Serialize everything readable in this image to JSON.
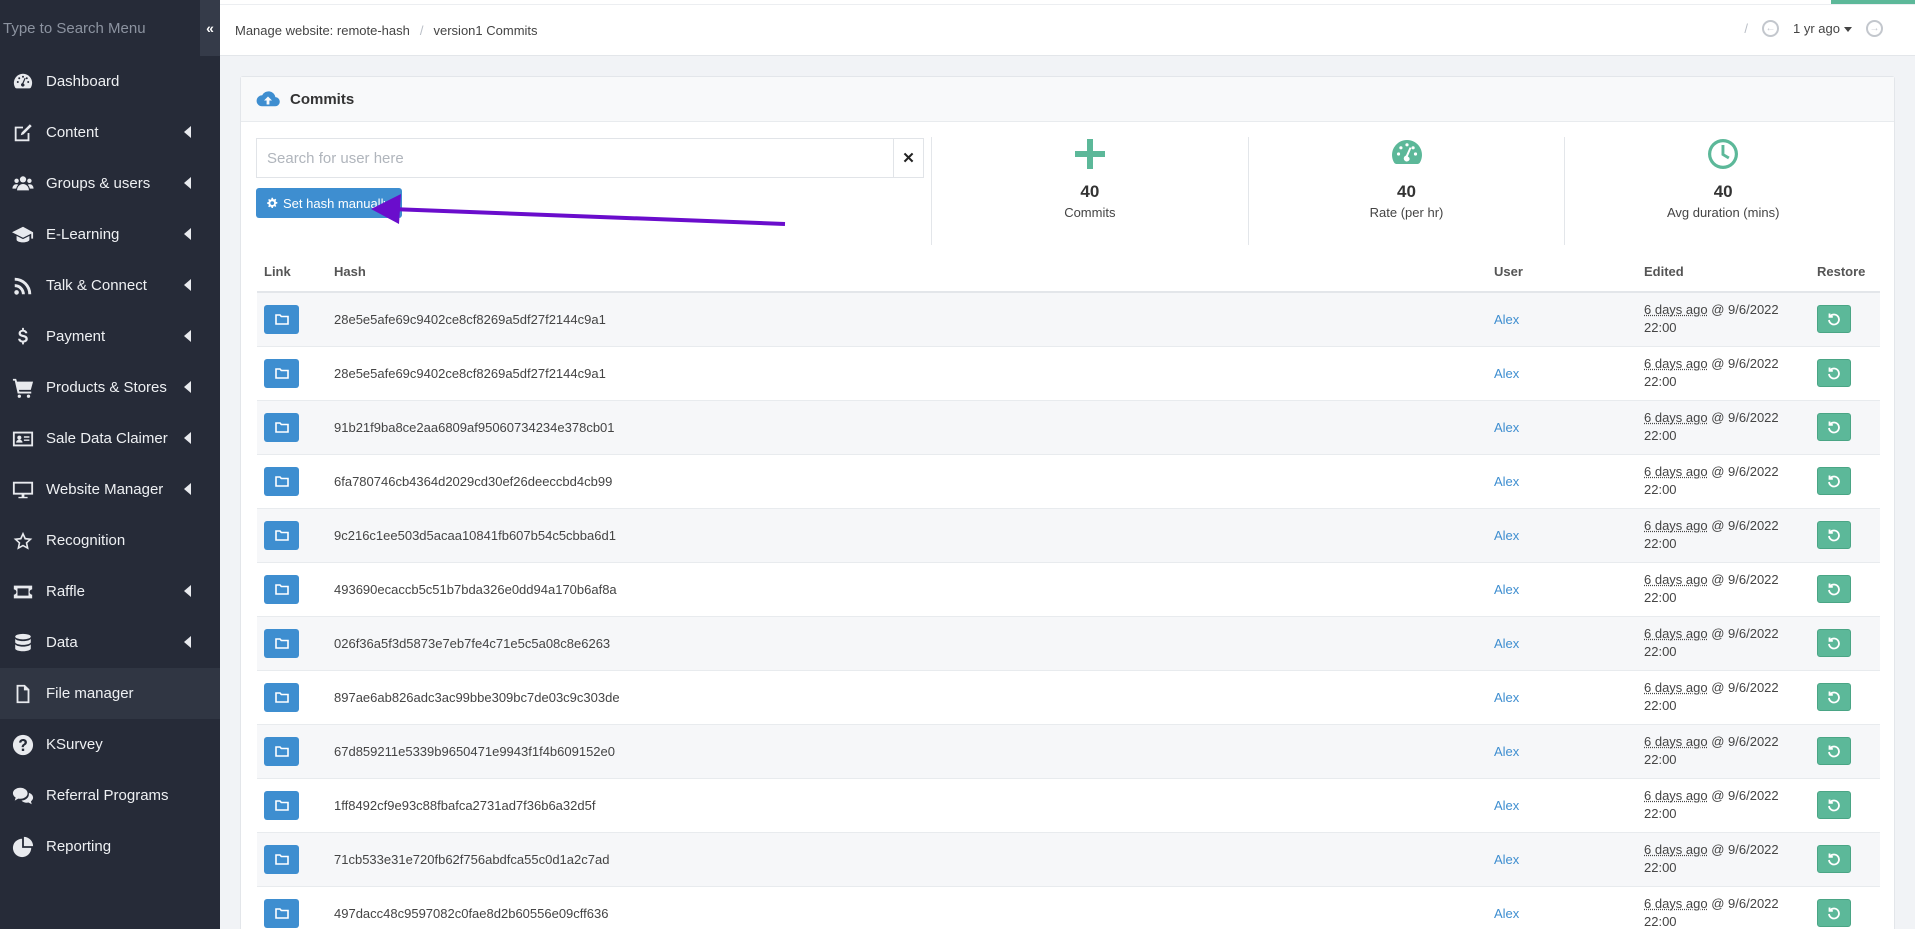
{
  "sidebar": {
    "search_placeholder": "Type to Search Menu",
    "collapse_icon": "«",
    "items": [
      {
        "label": "Dashboard",
        "icon": "dashboard-icon",
        "has_submenu": false
      },
      {
        "label": "Content",
        "icon": "edit-icon",
        "has_submenu": true
      },
      {
        "label": "Groups & users",
        "icon": "users-icon",
        "has_submenu": true
      },
      {
        "label": "E-Learning",
        "icon": "graduation-cap-icon",
        "has_submenu": true
      },
      {
        "label": "Talk & Connect",
        "icon": "rss-icon",
        "has_submenu": true
      },
      {
        "label": "Payment",
        "icon": "dollar-icon",
        "has_submenu": true
      },
      {
        "label": "Products & Stores",
        "icon": "cart-icon",
        "has_submenu": true
      },
      {
        "label": "Sale Data Claimer",
        "icon": "id-card-icon",
        "has_submenu": true
      },
      {
        "label": "Website Manager",
        "icon": "monitor-icon",
        "has_submenu": true
      },
      {
        "label": "Recognition",
        "icon": "star-icon",
        "has_submenu": false
      },
      {
        "label": "Raffle",
        "icon": "ticket-icon",
        "has_submenu": true
      },
      {
        "label": "Data",
        "icon": "database-icon",
        "has_submenu": true
      },
      {
        "label": "File manager",
        "icon": "file-icon",
        "has_submenu": false,
        "active": true
      },
      {
        "label": "KSurvey",
        "icon": "question-icon",
        "has_submenu": false
      },
      {
        "label": "Referral Programs",
        "icon": "comments-icon",
        "has_submenu": false
      },
      {
        "label": "Reporting",
        "icon": "pie-chart-icon",
        "has_submenu": false
      }
    ]
  },
  "topbar": {
    "breadcrumb": [
      "Manage website: remote-hash",
      "version1 Commits"
    ],
    "breadcrumb_sep": "/",
    "history_sep": "/",
    "history_label": "1 yr ago",
    "prev_icon": "←",
    "next_icon": "→"
  },
  "panel": {
    "title": "Commits",
    "search_placeholder": "Search for user here",
    "search_value": "",
    "clear_label": "✕",
    "set_hash_label": "Set hash manually"
  },
  "stats": [
    {
      "value": "40",
      "label": "Commits",
      "icon": "plus-icon"
    },
    {
      "value": "40",
      "label": "Rate (per hr)",
      "icon": "gauge-icon"
    },
    {
      "value": "40",
      "label": "Avg duration (mins)",
      "icon": "clock-icon"
    }
  ],
  "table": {
    "headers": [
      "Link",
      "Hash",
      "User",
      "Edited",
      "Restore"
    ],
    "rows": [
      {
        "hash": "28e5e5afe69c9402ce8cf8269a5df27f2144c9a1",
        "user": "Alex",
        "ago": "6 days ago",
        "date": " @ 9/6/2022",
        "time": "22:00"
      },
      {
        "hash": "28e5e5afe69c9402ce8cf8269a5df27f2144c9a1",
        "user": "Alex",
        "ago": "6 days ago",
        "date": " @ 9/6/2022",
        "time": "22:00"
      },
      {
        "hash": "91b21f9ba8ce2aa6809af95060734234e378cb01",
        "user": "Alex",
        "ago": "6 days ago",
        "date": " @ 9/6/2022",
        "time": "22:00"
      },
      {
        "hash": "6fa780746cb4364d2029cd30ef26deeccbd4cb99",
        "user": "Alex",
        "ago": "6 days ago",
        "date": " @ 9/6/2022",
        "time": "22:00"
      },
      {
        "hash": "9c216c1ee503d5acaa10841fb607b54c5cbba6d1",
        "user": "Alex",
        "ago": "6 days ago",
        "date": " @ 9/6/2022",
        "time": "22:00"
      },
      {
        "hash": "493690ecaccb5c51b7bda326e0dd94a170b6af8a",
        "user": "Alex",
        "ago": "6 days ago",
        "date": " @ 9/6/2022",
        "time": "22:00"
      },
      {
        "hash": "026f36a5f3d5873e7eb7fe4c71e5c5a08c8e6263",
        "user": "Alex",
        "ago": "6 days ago",
        "date": " @ 9/6/2022",
        "time": "22:00"
      },
      {
        "hash": "897ae6ab826adc3ac99bbe309bc7de03c9c303de",
        "user": "Alex",
        "ago": "6 days ago",
        "date": " @ 9/6/2022",
        "time": "22:00"
      },
      {
        "hash": "67d859211e5339b9650471e9943f1f4b609152e0",
        "user": "Alex",
        "ago": "6 days ago",
        "date": " @ 9/6/2022",
        "time": "22:00"
      },
      {
        "hash": "1ff8492cf9e93c88fbafca2731ad7f36b6a32d5f",
        "user": "Alex",
        "ago": "6 days ago",
        "date": " @ 9/6/2022",
        "time": "22:00"
      },
      {
        "hash": "71cb533e31e720fb62f756abdfca55c0d1a2c7ad",
        "user": "Alex",
        "ago": "6 days ago",
        "date": " @ 9/6/2022",
        "time": "22:00"
      },
      {
        "hash": "497dacc48c9597082c0fae8d2b60556e09cff636",
        "user": "Alex",
        "ago": "6 days ago",
        "date": " @ 9/6/2022",
        "time": "22:00"
      }
    ]
  },
  "colors": {
    "sidebar_bg": "#262b38",
    "primary": "#3e8ed0",
    "success": "#5cb899",
    "annotation_arrow": "#6a0dcc"
  }
}
